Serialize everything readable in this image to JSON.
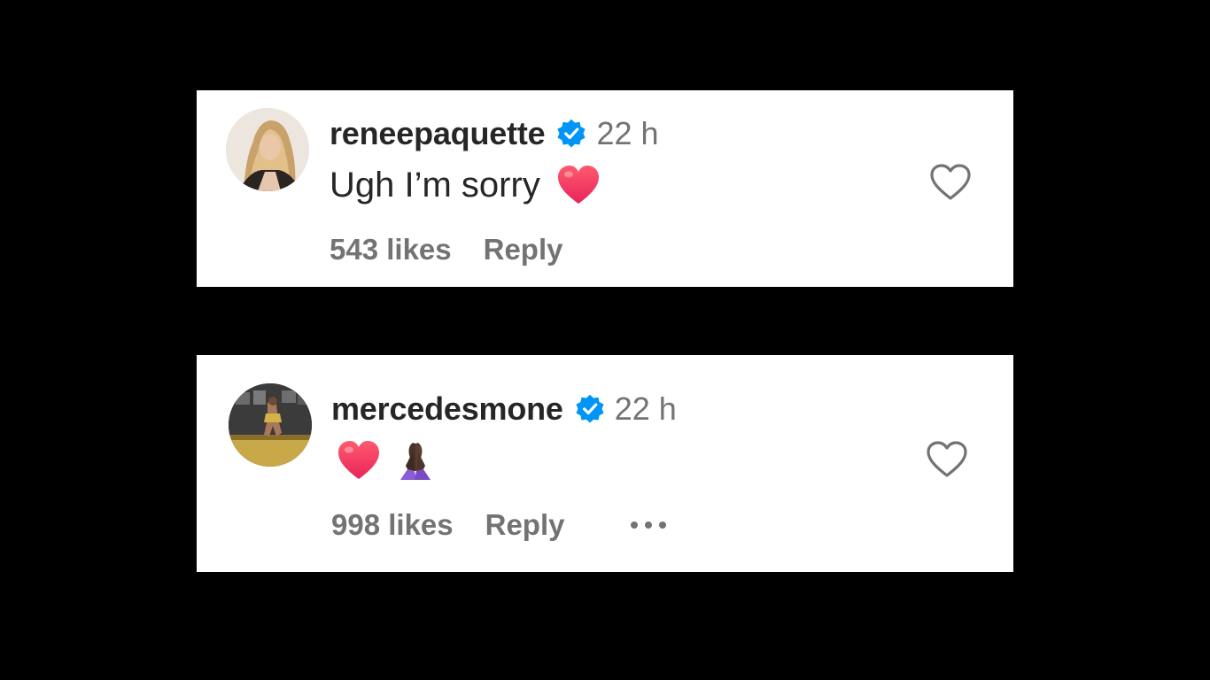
{
  "comments": [
    {
      "username": "reneepaquette",
      "verified": true,
      "time": "22 h",
      "text": "Ugh I’m sorry",
      "emojis": [
        "red-heart"
      ],
      "likes": "543 likes",
      "reply_label": "Reply",
      "has_more_options": false,
      "avatar_icon": "avatar-blonde-woman"
    },
    {
      "username": "mercedesmone",
      "verified": true,
      "time": "22 h",
      "text": "",
      "emojis": [
        "red-heart",
        "folded-hands-dark-skin"
      ],
      "likes": "998 likes",
      "reply_label": "Reply",
      "has_more_options": true,
      "avatar_icon": "avatar-wrestler-arena"
    }
  ],
  "colors": {
    "background": "#000000",
    "card": "#ffffff",
    "username": "#262626",
    "secondary_text": "#737373",
    "verified_badge": "#0095f6",
    "heart_emoji": "#f0405f"
  }
}
